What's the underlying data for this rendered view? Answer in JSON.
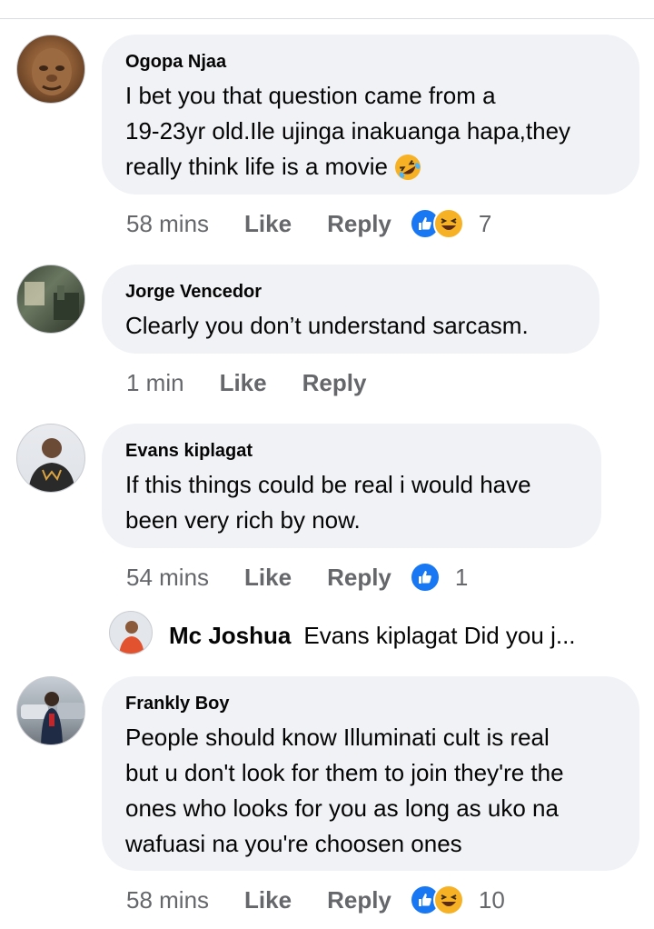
{
  "comments": [
    {
      "author": "Ogopa Njaa",
      "lines": [
        "I bet you that question came from a",
        "19-23yr old.Ile ujinga inakuanga hapa,they",
        "really think life is a movie"
      ],
      "emoji": "rolling-on-floor-laughing",
      "time": "58 mins",
      "like": "Like",
      "reply": "Reply",
      "reactions": [
        "like",
        "haha"
      ],
      "reaction_count": "7"
    },
    {
      "author": "Jorge Vencedor",
      "lines": [
        "Clearly you don’t understand sarcasm."
      ],
      "time": "1 min",
      "like": "Like",
      "reply": "Reply"
    },
    {
      "author": "Evans kiplagat",
      "lines": [
        "If this things could be real i would have",
        "been very rich by now."
      ],
      "time": "54 mins",
      "like": "Like",
      "reply": "Reply",
      "reactions": [
        "like"
      ],
      "reaction_count": "1"
    },
    {
      "author": "Frankly Boy",
      "lines": [
        "People should know Illuminati cult is real",
        "but u don't look for them to join they're the",
        "ones who looks for you as long as uko na",
        "wafuasi na you're choosen ones"
      ],
      "time": "58 mins",
      "like": "Like",
      "reply": "Reply",
      "reactions": [
        "like",
        "haha"
      ],
      "reaction_count": "10"
    }
  ],
  "reply_preview": {
    "author": "Mc Joshua",
    "text": "Evans kiplagat Did you j..."
  },
  "colors": {
    "bubble": "#f0f2f5",
    "secondary_text": "#65676b",
    "like_blue": "#1877f2",
    "haha_yellow": "#f7b125"
  }
}
